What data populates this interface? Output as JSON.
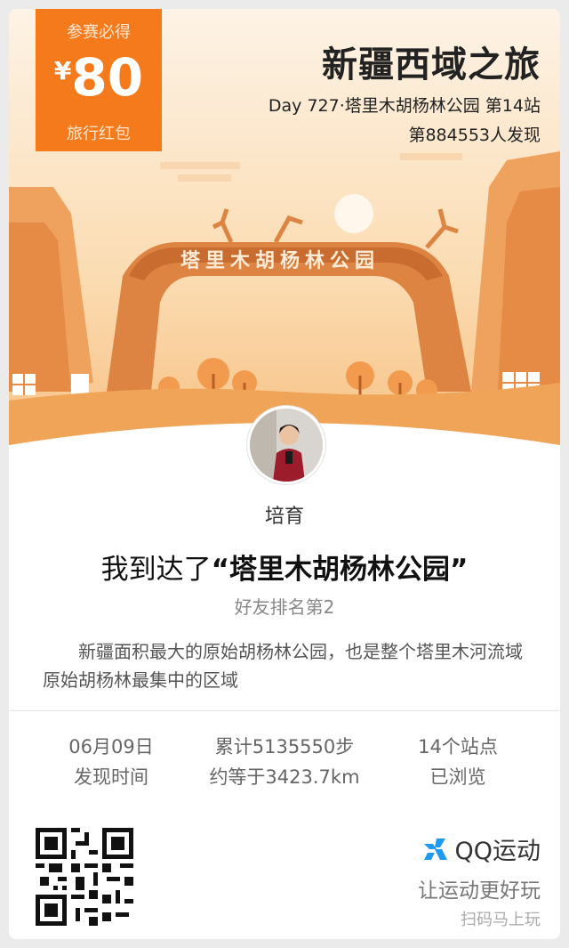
{
  "badge": {
    "top_label": "参赛必得",
    "currency": "¥",
    "amount": "80",
    "bottom_label": "旅行红包"
  },
  "header": {
    "title": "新疆西域之旅",
    "day_line": "Day 727·塔里木胡杨林公园 第14站",
    "discover_line": "第884553人发现"
  },
  "hero": {
    "arch_text": "塔里木胡杨林公园",
    "colors": {
      "sky": "#fbe3c2",
      "arch": "#e0894a",
      "ground": "#f2a85a"
    }
  },
  "user": {
    "avatar_icon": "user-avatar",
    "name": "培育"
  },
  "arrival": {
    "prefix": "我到达了",
    "place": "“塔里木胡杨林公园”",
    "rank": "好友排名第2",
    "description": "新疆面积最大的原始胡杨林公园，也是整个塔里木河流域原始胡杨林最集中的区域"
  },
  "stats": [
    {
      "value": "06月09日",
      "label": "发现时间"
    },
    {
      "value": "累计5135550步",
      "label": "约等于3423.7km"
    },
    {
      "value": "14个站点",
      "label": "已浏览"
    }
  ],
  "footer": {
    "qr_icon": "qr-code",
    "brand_icon": "qq-sport-run-icon",
    "brand_name": "QQ运动",
    "slogan": "让运动更好玩",
    "scan_hint": "扫码马上玩",
    "accent": "#1e9bf0"
  }
}
